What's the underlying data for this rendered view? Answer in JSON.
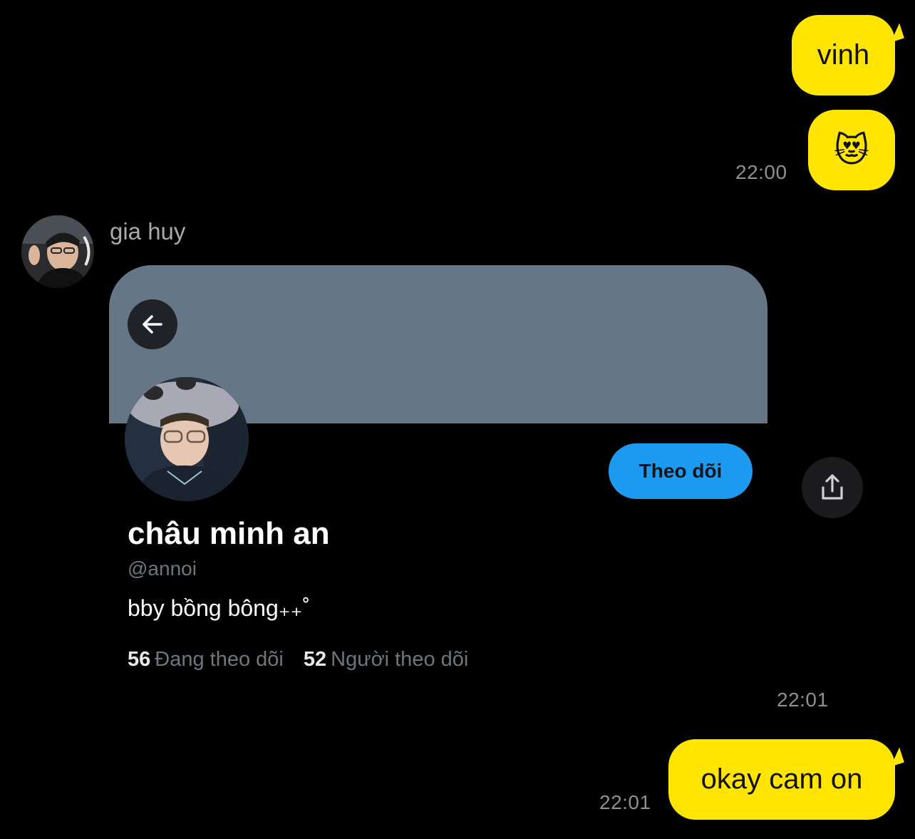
{
  "messages_out_top": [
    {
      "text": "vinh"
    },
    {
      "text": "😻"
    }
  ],
  "timestamps": {
    "first_block": "22:00",
    "shared_card": "22:01",
    "last_message": "22:01"
  },
  "incoming": {
    "sender_name": "gia huy"
  },
  "shared_profile": {
    "display_name": "châu minh an",
    "handle": "@annoi",
    "bio": "bby bồng bông₊₊˚",
    "follow_label": "Theo dõi",
    "following_count": "56",
    "following_label": "Đang theo dõi",
    "followers_count": "52",
    "followers_label": "Người theo dõi"
  },
  "message_out_bottom": {
    "text": "okay cam on"
  },
  "colors": {
    "bubble_out": "#FFE500",
    "banner": "#657786",
    "follow_button": "#1d9bf0",
    "background": "#000000"
  },
  "icons": {
    "back": "arrow-left-icon",
    "share": "share-upload-icon"
  }
}
